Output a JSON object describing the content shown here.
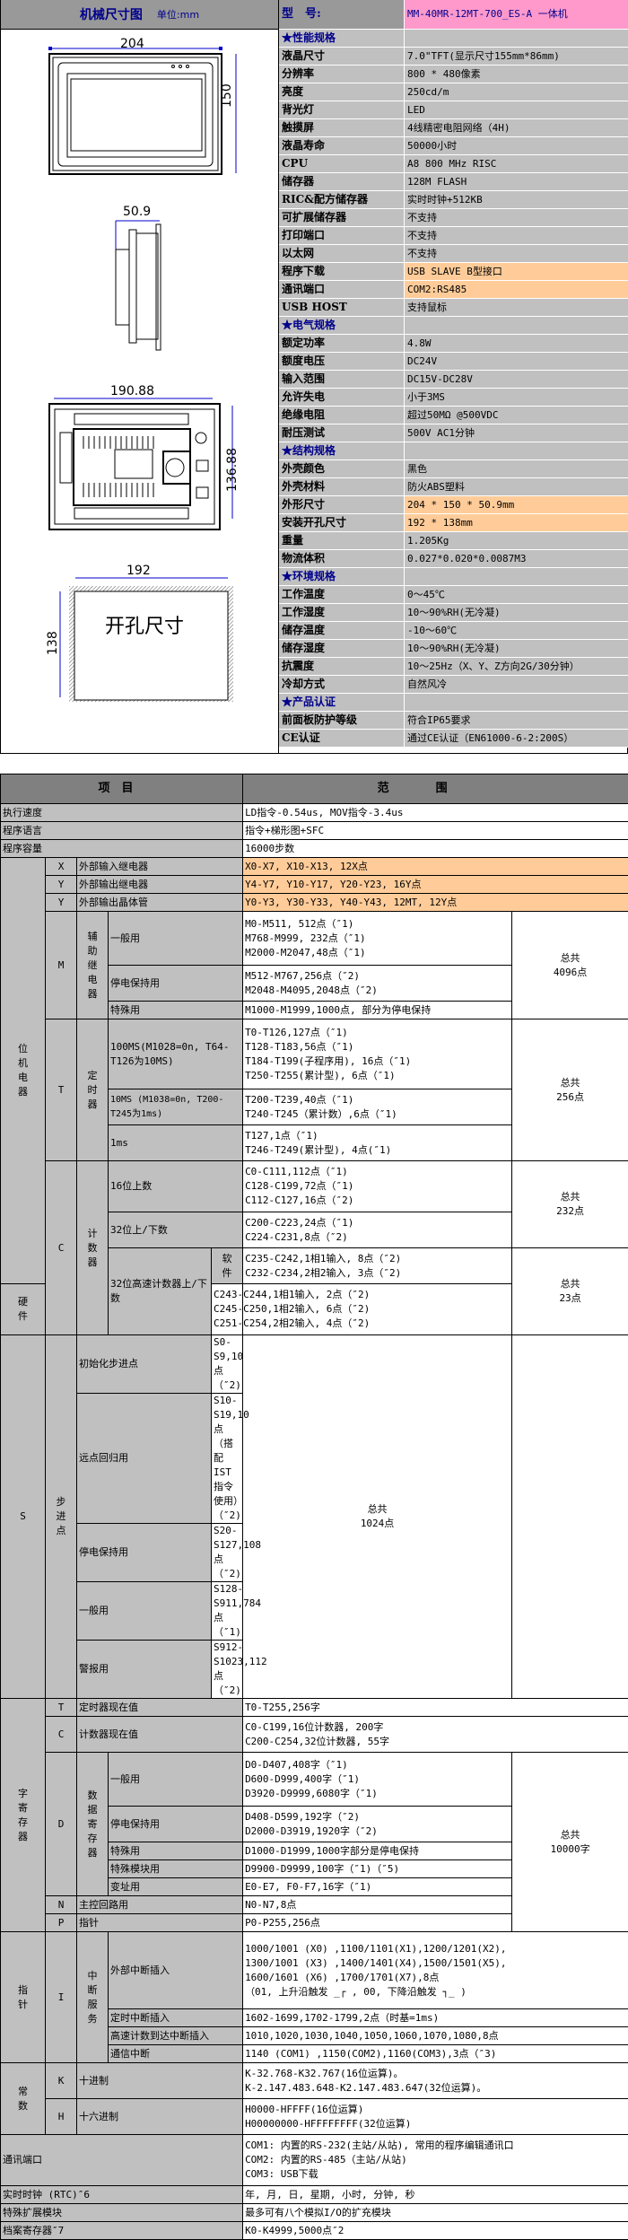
{
  "drawing": {
    "header_title": "机械尺寸图",
    "header_unit": "单位:mm",
    "front_width": "204",
    "front_height": "150",
    "side_depth": "50.9",
    "back_width": "190.88",
    "back_height": "136.88",
    "cutout_width": "192",
    "cutout_height": "138",
    "cutout_label": "开孔尺寸"
  },
  "spec": {
    "model_label": "型　号:",
    "model_value": "MM-40MR-12MT-700_ES-A 一体机",
    "rows": [
      {
        "label": "★性能规格",
        "value": "",
        "section": true
      },
      {
        "label": "液晶尺寸",
        "value": "7.0\"TFT(显示尺寸155mm*86mm)"
      },
      {
        "label": "分辨率",
        "value": "800 * 480像素"
      },
      {
        "label": "亮度",
        "value": "250cd/m"
      },
      {
        "label": "背光灯",
        "value": "LED"
      },
      {
        "label": "触摸屏",
        "value": "4线精密电阻网络（4H)"
      },
      {
        "label": "液晶寿命",
        "value": "50000小时"
      },
      {
        "label": "CPU",
        "value": "A8 800 MHz RISC"
      },
      {
        "label": "储存器",
        "value": "128M FLASH"
      },
      {
        "label": "RIC&配方储存器",
        "value": "实时时钟+512KB"
      },
      {
        "label": "可扩展储存器",
        "value": "不支持"
      },
      {
        "label": "打印端口",
        "value": "不支持"
      },
      {
        "label": "以太网",
        "value": "不支持"
      },
      {
        "label": "程序下载",
        "value": "USB SLAVE B型接口",
        "highlight": true
      },
      {
        "label": "通讯端口",
        "value": "COM2:RS485",
        "highlight": true
      },
      {
        "label": "USB HOST",
        "value": "支持鼠标"
      },
      {
        "label": "★电气规格",
        "value": "",
        "section": true
      },
      {
        "label": "额定功率",
        "value": "4.8W"
      },
      {
        "label": "额度电压",
        "value": "DC24V"
      },
      {
        "label": "输入范围",
        "value": "DC15V-DC28V"
      },
      {
        "label": "允许失电",
        "value": "小于3MS"
      },
      {
        "label": "绝缘电阻",
        "value": "超过50MΩ @500VDC"
      },
      {
        "label": "耐压测试",
        "value": "500V AC1分钟"
      },
      {
        "label": "★结构规格",
        "value": "",
        "section": true
      },
      {
        "label": "外壳颜色",
        "value": "黑色"
      },
      {
        "label": "外壳材料",
        "value": "防火ABS塑料"
      },
      {
        "label": "外形尺寸",
        "value": "204 * 150 * 50.9mm",
        "highlight": true
      },
      {
        "label": "安装开孔尺寸",
        "value": "192 * 138mm",
        "highlight": true
      },
      {
        "label": "重量",
        "value": "1.205Kg"
      },
      {
        "label": "物流体积",
        "value": "0.027*0.020*0.0087M3"
      },
      {
        "label": "★环境规格",
        "value": "",
        "section": true
      },
      {
        "label": "工作温度",
        "value": "0～45℃"
      },
      {
        "label": "工作湿度",
        "value": "10～90%RH(无冷凝)"
      },
      {
        "label": "储存温度",
        "value": "-10～60℃"
      },
      {
        "label": "储存湿度",
        "value": "10～90%RH(无冷凝)"
      },
      {
        "label": "抗震度",
        "value": "10～25Hz（X、Y、Z方向2G/30分钟）"
      },
      {
        "label": "冷却方式",
        "value": "自然风冷"
      },
      {
        "label": "★产品认证",
        "value": "",
        "section": true
      },
      {
        "label": "前面板防护等级",
        "value": "符合IP65要求"
      },
      {
        "label": "CE认证",
        "value": "通过CE认证（EN61000-6-2:200S）"
      }
    ]
  },
  "plc": {
    "head_item": "项目",
    "head_range": "范围",
    "exec_speed": {
      "label": "执行速度",
      "value": "LD指令-0.54us, MOV指令-3.4us"
    },
    "prog_lang": {
      "label": "程序语言",
      "value": "指令+梯形图+SFC"
    },
    "prog_cap": {
      "label": "程序容量",
      "value": "16000步数"
    },
    "bit_group": "位机电器",
    "word_group": "字寄存器",
    "pointer_group": "指针",
    "const_group": "常数",
    "x_in": {
      "code": "X",
      "label": "外部输入继电器",
      "value": "X0-X7, X10-X13, 12X点"
    },
    "y_relay": {
      "code": "Y",
      "label": "外部输出继电器",
      "value": "Y4-Y7, Y10-Y17, Y20-Y23, 16Y点"
    },
    "y_tr": {
      "code": "Y",
      "label": "外部输出晶体管",
      "value": "Y0-Y3, Y30-Y33, Y40-Y43, 12MT, 12Y点"
    },
    "m": {
      "code": "M",
      "group": "辅助继电器",
      "general": {
        "label": "一般用",
        "lines": [
          "M0-M511, 512点（″1)",
          "M768-M999, 232点（″1)",
          "M2000-M2047,48点（″1)"
        ]
      },
      "retain": {
        "label": "停电保持用",
        "lines": [
          "M512-M767,256点（″2)",
          "M2048-M4095,2048点（″2)"
        ]
      },
      "special": {
        "label": "特殊用",
        "value": "M1000-M1999,1000点, 部分为停电保持"
      },
      "total": [
        "总共",
        "4096点"
      ]
    },
    "t": {
      "code": "T",
      "group": "定时器",
      "ms100": {
        "label": "100MS(M1028=0n, T64-T126为10MS)",
        "lines": [
          "T0-T126,127点（″1)",
          "T128-T183,56点（″1)",
          "T184-T199(子程序用), 16点（″1)",
          "T250-T255(累计型), 6点（″1)"
        ]
      },
      "ms10": {
        "label": "10MS (M1038=0n, T200-T245为1ms)",
        "lines": [
          "T200-T239,40点（″1)",
          "T240-T245（累计数）,6点（″1)"
        ]
      },
      "ms1": {
        "label": "1ms",
        "lines": [
          "T127,1点（″1)",
          "T246-T249(累计型), 4点(″1)"
        ]
      },
      "total": [
        "总共",
        "256点"
      ]
    },
    "c": {
      "code": "C",
      "group": "计数器",
      "up16": {
        "label": "16位上数",
        "lines": [
          "C0-C111,112点（″1)",
          "C128-C199,72点（″1)",
          "C112-C127,16点（″2)"
        ]
      },
      "ud32": {
        "label": "32位上/下数",
        "lines": [
          "C200-C223,24点（″1)",
          "C224-C231,8点（″2)"
        ]
      },
      "total1": [
        "总共",
        "232点"
      ],
      "hs": {
        "label": "32位高速计数器上/下数",
        "soft": {
          "label": "软件",
          "lines": [
            "C235-C242,1相1输入, 8点（″2)",
            "C232-C234,2相2输入, 3点（″2)"
          ]
        },
        "hard": {
          "label": "硬件",
          "lines": [
            "C243-C244,1相1输入, 2点（″2)",
            "C245-C250,1相2输入, 6点（″2)",
            "C251-C254,2相2输入, 4点（″2)"
          ]
        }
      },
      "total2": [
        "总共",
        "23点"
      ]
    },
    "s": {
      "code": "S",
      "group": "步进点",
      "rows": [
        {
          "label": "初始化步进点",
          "value": "S0-S9,10点（″2)"
        },
        {
          "label": "远点回归用",
          "value": "S10-S19,10点（搭配IST指令使用）（″2)"
        },
        {
          "label": "停电保持用",
          "value": "S20-S127,108点（″2)"
        },
        {
          "label": "一般用",
          "value": "S128-S911,784点（″1)"
        },
        {
          "label": "警报用",
          "value": "S912-S1023,112点（″2)"
        }
      ],
      "total": [
        "总共",
        "1024点"
      ]
    },
    "t_cur": {
      "code": "T",
      "label": "定时器现在值",
      "value": "T0-T255,256字"
    },
    "c_cur": {
      "code": "C",
      "label": "计数器现在值",
      "lines": [
        "C0-C199,16位计数器, 200字",
        "C200-C254,32位计数器, 55字"
      ]
    },
    "d": {
      "code": "D",
      "group": "数据寄存器",
      "general": {
        "label": "一般用",
        "lines": [
          "D0-D407,408字（″1)",
          "D600-D999,400字（″1)",
          "D3920-D9999,6080字（″1)"
        ]
      },
      "retain": {
        "label": "停电保持用",
        "lines": [
          "D408-D599,192字（″2)",
          "D2000-D3919,1920字（″2)"
        ]
      },
      "special": {
        "label": "特殊用",
        "value": "D1000-D1999,1000字部分是停电保持"
      },
      "module": {
        "label": "特殊模块用",
        "value": "D9900-D9999,100字（″1)（″5)"
      },
      "index": {
        "label": "变址用",
        "value": "E0-E7, F0-F7,16字（″1)"
      },
      "total": [
        "总共",
        "10000字"
      ]
    },
    "n": {
      "code": "N",
      "label": "主控回路用",
      "value": "N0-N7,8点"
    },
    "p": {
      "code": "P",
      "label": "指针",
      "value": "P0-P255,256点"
    },
    "i": {
      "code": "I",
      "group": "中断服务",
      "ext": {
        "label": "外部中断插入",
        "lines": [
          "1000/1001 (X0) ,1100/1101(X1),1200/1201(X2),",
          "1300/1001 (X3) ,1400/1401(X4),1500/1501(X5),",
          "1600/1601 (X6) ,1700/1701(X7),8点",
          "（01, 上升沿触发 _┌ ,    00, 下降沿触发 ┐_ )"
        ]
      },
      "timer": {
        "label": "定时中断插入",
        "value": "1602-1699,1702-1799,2点（时基=1ms)"
      },
      "hsc": {
        "label": "高速计数到达中断插入",
        "value": "1010,1020,1030,1040,1050,1060,1070,1080,8点"
      },
      "comm": {
        "label": "通信中断",
        "value": "1140 (COM1) ,1150(COM2),1160(COM3),3点（″3)"
      }
    },
    "k": {
      "code": "K",
      "label": "十进制",
      "lines": [
        "K-32.768-K32.767(16位运算)。",
        "K-2.147.483.648-K2.147.483.647(32位运算)。"
      ]
    },
    "h": {
      "code": "H",
      "label": "十六进制",
      "lines": [
        "H0000-HFFFF(16位运算)",
        "H00000000-HFFFFFFFF(32位运算)"
      ]
    },
    "comm_port": {
      "label": "通讯端口",
      "lines": [
        "COM1: 内置的RS-232(主站/从站), 常用的程序编辑通讯口",
        "COM2: 内置的RS-485（主站/从站)",
        "COM3: USB下载"
      ]
    },
    "rtc": {
      "label": "实时时钟 (RTC)″6",
      "value": "年, 月, 日, 星期, 小时, 分钟, 秒"
    },
    "ext_module": {
      "label": "特殊扩展模块",
      "value": "最多可有八个模拟I/O的扩充模块"
    },
    "file_reg": {
      "label": "档案寄存器″7",
      "value": "K0-K4999,5000点″2"
    }
  }
}
